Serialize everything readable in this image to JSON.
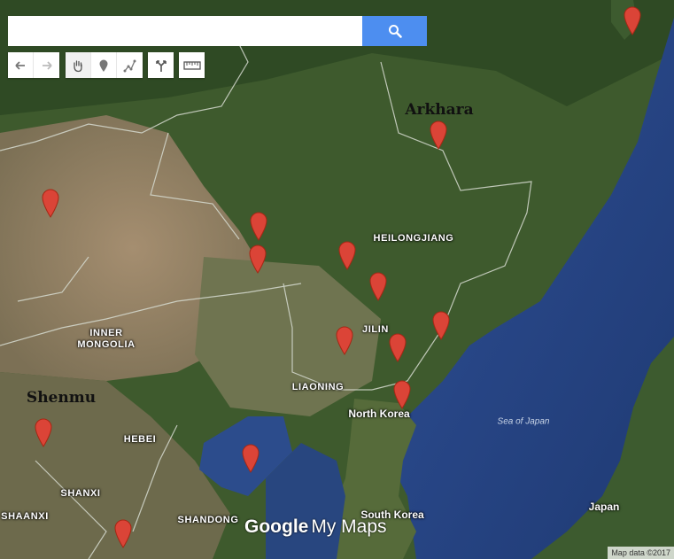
{
  "search": {
    "placeholder": "",
    "value": ""
  },
  "toolbar": {
    "undo": "undo-icon",
    "redo": "redo-icon",
    "pan": "hand-icon",
    "marker": "marker-icon",
    "line": "draw-line-icon",
    "directions": "directions-icon",
    "measure": "ruler-icon"
  },
  "custom_labels": {
    "arkhara": "Arkhara",
    "shenmu": "Shenmu"
  },
  "regions": {
    "heilongjiang": "HEILONGJIANG",
    "jilin": "JILIN",
    "inner_mongolia_1": "INNER",
    "inner_mongolia_2": "MONGOLIA",
    "liaoning": "LIAONING",
    "hebei": "HEBEI",
    "shanxi": "SHANXI",
    "shaanxi": "SHAANXI",
    "shandong": "SHANDONG"
  },
  "countries": {
    "north_korea": "North Korea",
    "south_korea": "South Korea",
    "japan": "Japan"
  },
  "sea": {
    "sea_of_japan": "Sea of Japan"
  },
  "logo": {
    "google": "Google",
    "my_maps": "My Maps"
  },
  "attribution": "Map data ©2017",
  "colors": {
    "marker": "#db4437",
    "water": "#2b4b8a",
    "land": "#3b5a2c",
    "search_button": "#4d8ef0"
  }
}
